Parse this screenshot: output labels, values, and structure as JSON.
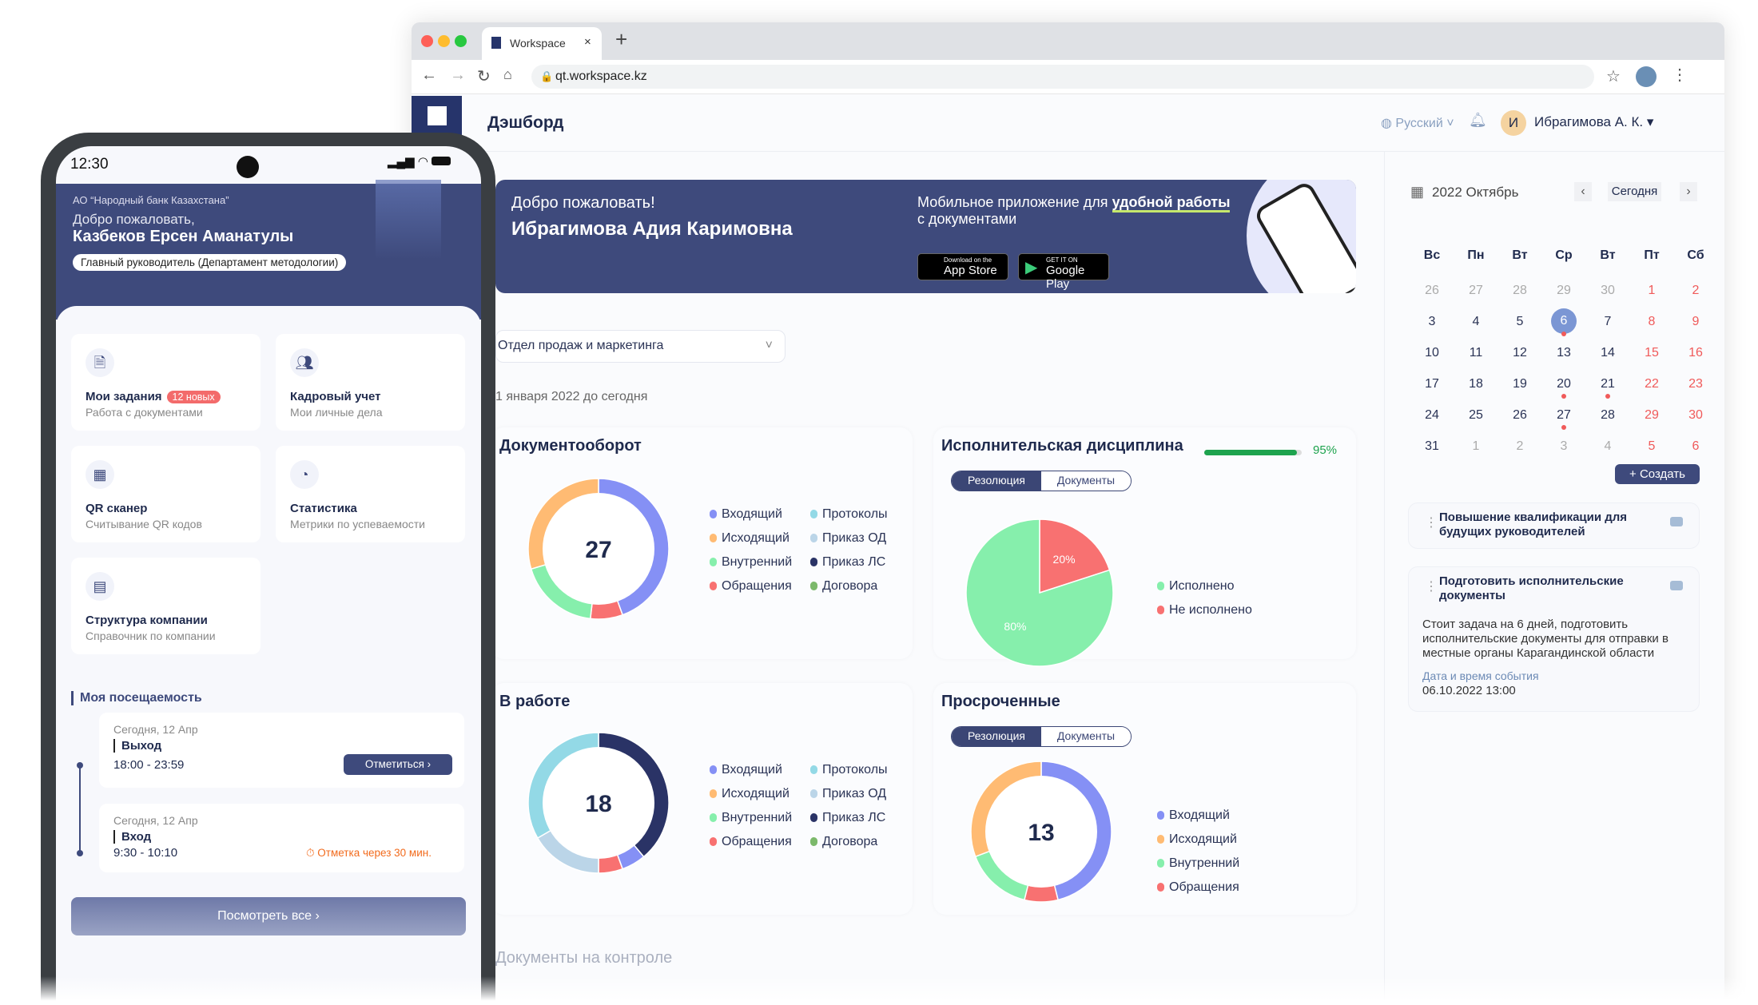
{
  "browser": {
    "tab_title": "Workspace",
    "url": "qt.workspace.kz"
  },
  "header": {
    "title": "Дэшборд",
    "language": "Русский",
    "user_initial": "И",
    "user_name": "Ибрагимова А. К."
  },
  "banner": {
    "greeting": "Добро пожаловать!",
    "name": "Ибрагимова Адия Каримовна",
    "promo_prefix": "Мобильное приложение для ",
    "promo_bold": "удобной работы",
    "promo_suffix": "с документами",
    "appstore_small": "Download on the",
    "appstore_big": "App Store",
    "gplay_small": "GET IT ON",
    "gplay_big": "Google Play"
  },
  "filter": {
    "department": "Отдел продаж и маркетинга",
    "period": "1 января 2022 до сегодня"
  },
  "toggle": {
    "a": "Резолюция",
    "b": "Документы"
  },
  "colors": {
    "Входящий": "#8590F5",
    "Исходящий": "#FFBB73",
    "Внутренний": "#86EFAC",
    "Обращения": "#F87171",
    "Протоколы": "#93D9E6",
    "Приказ ОД": "#BBD5E8",
    "Приказ ЛС": "#2A3366",
    "Договора": "#7CB96B",
    "Исполнено": "#86EFAC",
    "Не исполнено": "#F87171",
    "accent": "#3E4A7C"
  },
  "chart_data": [
    {
      "type": "donut",
      "title": "Документооборот",
      "total": "27",
      "legend": [
        "Входящий",
        "Исходящий",
        "Внутренний",
        "Обращения",
        "Протоколы",
        "Приказ ОД",
        "Приказ ЛС",
        "Договора"
      ],
      "slices": [
        {
          "name": "Входящий",
          "value": 12
        },
        {
          "name": "Обращения",
          "value": 2
        },
        {
          "name": "Внутренний",
          "value": 5
        },
        {
          "name": "Исходящий",
          "value": 8
        }
      ]
    },
    {
      "type": "pie",
      "title": "Исполнительская дисциплина",
      "progress_percent": 95,
      "progress_label": "95%",
      "legend": [
        "Исполнено",
        "Не исполнено"
      ],
      "slices": [
        {
          "name": "Не исполнено",
          "value": 20,
          "label": "20%"
        },
        {
          "name": "Исполнено",
          "value": 80,
          "label": "80%"
        }
      ]
    },
    {
      "type": "donut",
      "title": "В работе",
      "total": "18",
      "legend": [
        "Входящий",
        "Исходящий",
        "Внутренний",
        "Обращения",
        "Протоколы",
        "Приказ ОД",
        "Приказ ЛС",
        "Договора"
      ],
      "slices": [
        {
          "name": "Приказ ЛС",
          "value": 7
        },
        {
          "name": "Входящий",
          "value": 1
        },
        {
          "name": "Обращения",
          "value": 1
        },
        {
          "name": "Приказ ОД",
          "value": 3
        },
        {
          "name": "Протоколы",
          "value": 6
        }
      ]
    },
    {
      "type": "donut",
      "title": "Просроченные",
      "total": "13",
      "legend": [
        "Входящий",
        "Исходящий",
        "Внутренний",
        "Обращения"
      ],
      "slices": [
        {
          "name": "Входящий",
          "value": 6
        },
        {
          "name": "Обращения",
          "value": 1
        },
        {
          "name": "Внутренний",
          "value": 2
        },
        {
          "name": "Исходящий",
          "value": 4
        }
      ]
    }
  ],
  "controlled_docs": "Документы на контроле",
  "calendar": {
    "title": "2022 Октябрь",
    "today_label": "Сегодня",
    "weekdays": [
      "Вс",
      "Пн",
      "Вт",
      "Ср",
      "Вт",
      "Пт",
      "Сб"
    ],
    "weeks": [
      [
        "26",
        "27",
        "28",
        "29",
        "30",
        "1",
        "2"
      ],
      [
        "3",
        "4",
        "5",
        "6",
        "7",
        "8",
        "9"
      ],
      [
        "10",
        "11",
        "12",
        "13",
        "14",
        "15",
        "16"
      ],
      [
        "17",
        "18",
        "19",
        "20",
        "21",
        "22",
        "23"
      ],
      [
        "24",
        "25",
        "26",
        "27",
        "28",
        "29",
        "30"
      ],
      [
        "31",
        "1",
        "2",
        "3",
        "4",
        "5",
        "6"
      ]
    ],
    "muted": [
      "0-0",
      "0-1",
      "0-2",
      "0-3",
      "0-4",
      "5-1",
      "5-2",
      "5-3",
      "5-4"
    ],
    "selected": "1-3",
    "event_dots": [
      "1-3",
      "3-3",
      "3-4",
      "4-3"
    ],
    "create_label": "+ Создать"
  },
  "events": [
    {
      "title": "Повышение квалификации для будущих руководителей"
    },
    {
      "title": "Подготовить исполнительские документы",
      "description": "Стоит задача на 6 дней, подготовить исполнительские документы для отправки в местные органы Карагандинской области",
      "date_label": "Дата и время события",
      "date": "06.10.2022 13:00"
    }
  ],
  "phone": {
    "time": "12:30",
    "org": "АО “Народный банк Казахстана”",
    "greeting": "Добро пожаловать,",
    "name": "Казбеков Ерсен Аманатулы",
    "role": "Главный руководитель (Департамент методологии)",
    "tiles": [
      {
        "title": "Мои задания",
        "badge": "12 новых",
        "sub": "Работа с документами",
        "icon": "document-icon"
      },
      {
        "title": "Кадровый учет",
        "sub": "Мои личные дела",
        "icon": "users-icon"
      },
      {
        "title": "QR сканер",
        "sub": "Считывание QR кодов",
        "icon": "qr-icon"
      },
      {
        "title": "Статистика",
        "sub": "Метрики по успеваемости",
        "icon": "pie-chart-icon"
      },
      {
        "title": "Структура компании",
        "sub": "Справочник по компании",
        "icon": "building-icon"
      }
    ],
    "attendance_title": "Моя посещаемость",
    "attendance": [
      {
        "date": "Сегодня, 12 Апр",
        "type": "Выход",
        "time": "18:00 - 23:59",
        "action": "Отметиться"
      },
      {
        "date": "Сегодня, 12 Апр",
        "type": "Вход",
        "time": "9:30 - 10:10",
        "notice": "Отметка через 30 мин."
      }
    ],
    "view_all": "Посмотреть все"
  }
}
